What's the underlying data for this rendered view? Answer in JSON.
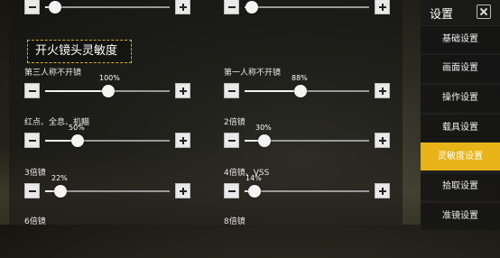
{
  "section_title": "开火镜头灵敏度",
  "settings": [
    {
      "label": "第三人称不开镜",
      "percent": "100%",
      "fraction": 0.51
    },
    {
      "label": "第一人称不开镜",
      "percent": "88%",
      "fraction": 0.45
    },
    {
      "label": "红点、全息、机瞄",
      "percent": "50%",
      "fraction": 0.26
    },
    {
      "label": "2倍镜",
      "percent": "30%",
      "fraction": 0.16
    },
    {
      "label": "3倍镜",
      "percent": "22%",
      "fraction": 0.12
    },
    {
      "label": "4倍镜、VSS",
      "percent": "14%",
      "fraction": 0.08
    },
    {
      "label": "6倍镜"
    },
    {
      "label": "8倍镜"
    }
  ],
  "top_sliders": [
    {
      "fraction": 0.08
    },
    {
      "fraction": 0.06
    }
  ],
  "sidebar": {
    "title": "设置",
    "items": [
      {
        "label": "基础设置"
      },
      {
        "label": "画面设置"
      },
      {
        "label": "操作设置"
      },
      {
        "label": "载具设置"
      },
      {
        "label": "灵敏度设置",
        "active": true
      },
      {
        "label": "拾取设置"
      },
      {
        "label": "准镜设置"
      }
    ]
  },
  "colors": {
    "accent": "#e8b318"
  }
}
